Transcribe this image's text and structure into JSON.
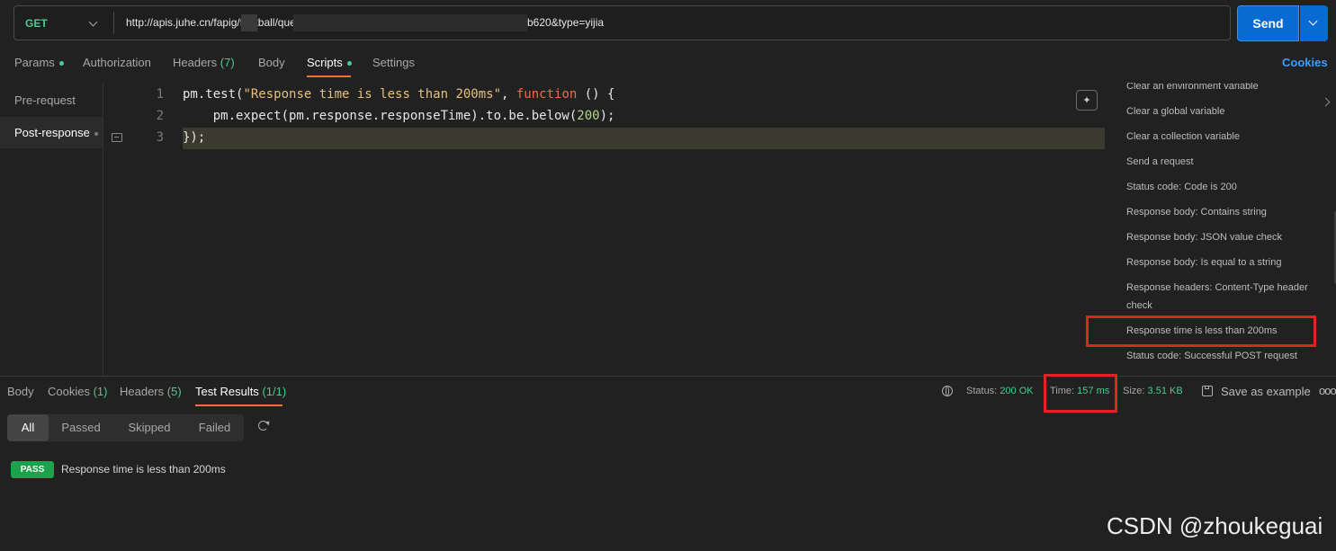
{
  "request": {
    "method": "GET",
    "url_visible_start": "http://apis.juhe.cn/fapig/football/query?key=9d",
    "url_visible_end": "b620&type=yijia",
    "send_label": "Send"
  },
  "request_tabs": [
    {
      "label": "Params",
      "dot": true
    },
    {
      "label": "Authorization"
    },
    {
      "label": "Headers",
      "count": "(7)"
    },
    {
      "label": "Body"
    },
    {
      "label": "Scripts",
      "dot": true,
      "active": true
    },
    {
      "label": "Settings"
    }
  ],
  "cookies_label": "Cookies",
  "script_tabs": [
    {
      "label": "Pre-request"
    },
    {
      "label": "Post-response",
      "active": true
    }
  ],
  "editor": {
    "lines": [
      {
        "num": "1",
        "text": "pm.test(\"Response time is less than 200ms\", function () {"
      },
      {
        "num": "2",
        "text": "    pm.expect(pm.response.responseTime).to.be.below(200);"
      },
      {
        "num": "3",
        "text": "});"
      }
    ],
    "line1": {
      "a": "pm.test(",
      "str": "\"Response time is less than 200ms\"",
      "b": ", ",
      "kw": "function",
      "c": " () {"
    },
    "line2": {
      "a": "    pm.expect(pm.response.responseTime).to.be.below(",
      "num": "200",
      "b": ");"
    },
    "line3": "});"
  },
  "snippets": [
    "Clear an environment variable",
    "Clear a global variable",
    "Clear a collection variable",
    "Send a request",
    "Status code: Code is 200",
    "Response body: Contains string",
    "Response body: JSON value check",
    "Response body: Is equal to a string",
    "Response headers: Content-Type header check",
    "Response time is less than 200ms",
    "Status code: Successful POST request"
  ],
  "response_tabs": [
    {
      "label": "Body"
    },
    {
      "label": "Cookies",
      "count": "(1)"
    },
    {
      "label": "Headers",
      "count": "(5)"
    },
    {
      "label": "Test Results",
      "count": "(1/1)",
      "active": true
    }
  ],
  "response_meta": {
    "status_label": "Status:",
    "status_value": "200 OK",
    "time_label": "Time:",
    "time_value": "157 ms",
    "size_label": "Size:",
    "size_value": "3.51 KB",
    "save_label": "Save as example",
    "more_label": "ooo"
  },
  "filters": [
    "All",
    "Passed",
    "Skipped",
    "Failed"
  ],
  "results": [
    {
      "badge": "PASS",
      "name": "Response time is less than 200ms"
    }
  ],
  "watermark": "CSDN @zhoukeguai",
  "colors": {
    "accent_orange": "#ff6c37",
    "send_blue": "#0a6ad4",
    "success_green": "#49cc8f",
    "pass_badge": "#1aa34a",
    "highlight_red": "#e02424"
  }
}
